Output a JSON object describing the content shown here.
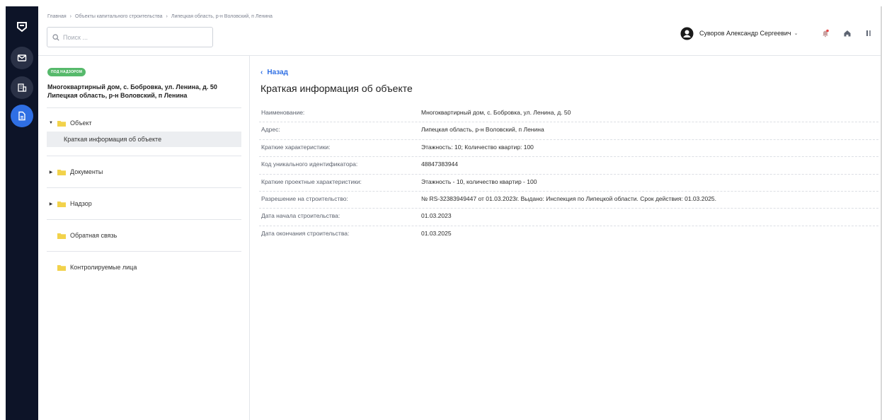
{
  "breadcrumb": [
    "Главная",
    "Объекты капитального строительства",
    "Липецкая область, р-н Воловский, п Ленина"
  ],
  "search": {
    "placeholder": "Поиск ..."
  },
  "user": {
    "name": "Суворов Александр Сергеевич"
  },
  "icons": {
    "logo": "shield-logo-icon",
    "rail": [
      "mail-icon",
      "building-icon",
      "document-icon"
    ],
    "header": [
      "bell-icon",
      "home-icon",
      "logout-icon"
    ]
  },
  "colors": {
    "accent": "#2f6fe4",
    "rail": "#0d1428",
    "badge": "#56b96b",
    "folder": "#f2d24b",
    "bell": "#e64646"
  },
  "object": {
    "status": "ПОД НАДЗОРОМ",
    "title_line1": "Многоквартирный дом, с. Бобровка, ул. Ленина, д. 50",
    "title_line2": "Липецкая область, р-н Воловский, п Ленина"
  },
  "tree": {
    "object": "Объект",
    "object_sub": "Краткая информация об объекте",
    "documents": "Документы",
    "supervision": "Надзор",
    "feedback": "Обратная связь",
    "controlled": "Контролируемые лица"
  },
  "main": {
    "back": "Назад",
    "title": "Краткая информация об объекте",
    "rows": [
      {
        "label": "Наименование:",
        "value": "Многоквартирный дом, с. Бобровка, ул. Ленина, д. 50"
      },
      {
        "label": "Адрес:",
        "value": "Липецкая область, р-н Воловский, п Ленина"
      },
      {
        "label": "Краткие характеристики:",
        "value": "Этажность: 10; Количество квартир: 100"
      },
      {
        "label": "Код уникального идентификатора:",
        "value": "48847383944"
      },
      {
        "label": "Краткие проектные характеристики:",
        "value": "Этажность - 10, количество квартир - 100"
      },
      {
        "label": "Разрешение на строительство:",
        "value": "№ RS-32383949447 от 01.03.2023г. Выдано: Инспекция по Липецкой области. Срок действия: 01.03.2025."
      },
      {
        "label": "Дата начала строительства:",
        "value": "01.03.2023"
      },
      {
        "label": "Дата окончания строительства:",
        "value": "01.03.2025"
      }
    ]
  }
}
